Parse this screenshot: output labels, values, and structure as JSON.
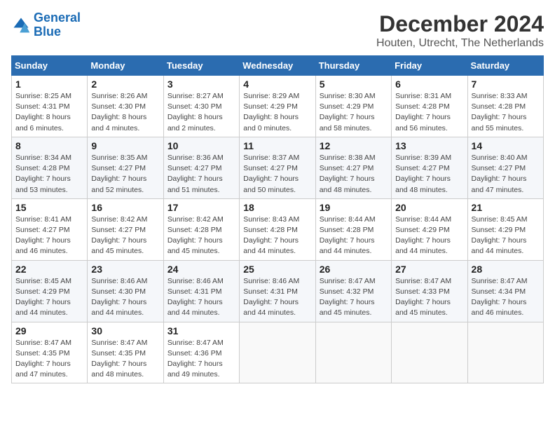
{
  "header": {
    "logo_line1": "General",
    "logo_line2": "Blue",
    "month": "December 2024",
    "location": "Houten, Utrecht, The Netherlands"
  },
  "weekdays": [
    "Sunday",
    "Monday",
    "Tuesday",
    "Wednesday",
    "Thursday",
    "Friday",
    "Saturday"
  ],
  "weeks": [
    [
      {
        "day": "1",
        "sunrise": "Sunrise: 8:25 AM",
        "sunset": "Sunset: 4:31 PM",
        "daylight": "Daylight: 8 hours and 6 minutes."
      },
      {
        "day": "2",
        "sunrise": "Sunrise: 8:26 AM",
        "sunset": "Sunset: 4:30 PM",
        "daylight": "Daylight: 8 hours and 4 minutes."
      },
      {
        "day": "3",
        "sunrise": "Sunrise: 8:27 AM",
        "sunset": "Sunset: 4:30 PM",
        "daylight": "Daylight: 8 hours and 2 minutes."
      },
      {
        "day": "4",
        "sunrise": "Sunrise: 8:29 AM",
        "sunset": "Sunset: 4:29 PM",
        "daylight": "Daylight: 8 hours and 0 minutes."
      },
      {
        "day": "5",
        "sunrise": "Sunrise: 8:30 AM",
        "sunset": "Sunset: 4:29 PM",
        "daylight": "Daylight: 7 hours and 58 minutes."
      },
      {
        "day": "6",
        "sunrise": "Sunrise: 8:31 AM",
        "sunset": "Sunset: 4:28 PM",
        "daylight": "Daylight: 7 hours and 56 minutes."
      },
      {
        "day": "7",
        "sunrise": "Sunrise: 8:33 AM",
        "sunset": "Sunset: 4:28 PM",
        "daylight": "Daylight: 7 hours and 55 minutes."
      }
    ],
    [
      {
        "day": "8",
        "sunrise": "Sunrise: 8:34 AM",
        "sunset": "Sunset: 4:28 PM",
        "daylight": "Daylight: 7 hours and 53 minutes."
      },
      {
        "day": "9",
        "sunrise": "Sunrise: 8:35 AM",
        "sunset": "Sunset: 4:27 PM",
        "daylight": "Daylight: 7 hours and 52 minutes."
      },
      {
        "day": "10",
        "sunrise": "Sunrise: 8:36 AM",
        "sunset": "Sunset: 4:27 PM",
        "daylight": "Daylight: 7 hours and 51 minutes."
      },
      {
        "day": "11",
        "sunrise": "Sunrise: 8:37 AM",
        "sunset": "Sunset: 4:27 PM",
        "daylight": "Daylight: 7 hours and 50 minutes."
      },
      {
        "day": "12",
        "sunrise": "Sunrise: 8:38 AM",
        "sunset": "Sunset: 4:27 PM",
        "daylight": "Daylight: 7 hours and 48 minutes."
      },
      {
        "day": "13",
        "sunrise": "Sunrise: 8:39 AM",
        "sunset": "Sunset: 4:27 PM",
        "daylight": "Daylight: 7 hours and 48 minutes."
      },
      {
        "day": "14",
        "sunrise": "Sunrise: 8:40 AM",
        "sunset": "Sunset: 4:27 PM",
        "daylight": "Daylight: 7 hours and 47 minutes."
      }
    ],
    [
      {
        "day": "15",
        "sunrise": "Sunrise: 8:41 AM",
        "sunset": "Sunset: 4:27 PM",
        "daylight": "Daylight: 7 hours and 46 minutes."
      },
      {
        "day": "16",
        "sunrise": "Sunrise: 8:42 AM",
        "sunset": "Sunset: 4:27 PM",
        "daylight": "Daylight: 7 hours and 45 minutes."
      },
      {
        "day": "17",
        "sunrise": "Sunrise: 8:42 AM",
        "sunset": "Sunset: 4:28 PM",
        "daylight": "Daylight: 7 hours and 45 minutes."
      },
      {
        "day": "18",
        "sunrise": "Sunrise: 8:43 AM",
        "sunset": "Sunset: 4:28 PM",
        "daylight": "Daylight: 7 hours and 44 minutes."
      },
      {
        "day": "19",
        "sunrise": "Sunrise: 8:44 AM",
        "sunset": "Sunset: 4:28 PM",
        "daylight": "Daylight: 7 hours and 44 minutes."
      },
      {
        "day": "20",
        "sunrise": "Sunrise: 8:44 AM",
        "sunset": "Sunset: 4:29 PM",
        "daylight": "Daylight: 7 hours and 44 minutes."
      },
      {
        "day": "21",
        "sunrise": "Sunrise: 8:45 AM",
        "sunset": "Sunset: 4:29 PM",
        "daylight": "Daylight: 7 hours and 44 minutes."
      }
    ],
    [
      {
        "day": "22",
        "sunrise": "Sunrise: 8:45 AM",
        "sunset": "Sunset: 4:29 PM",
        "daylight": "Daylight: 7 hours and 44 minutes."
      },
      {
        "day": "23",
        "sunrise": "Sunrise: 8:46 AM",
        "sunset": "Sunset: 4:30 PM",
        "daylight": "Daylight: 7 hours and 44 minutes."
      },
      {
        "day": "24",
        "sunrise": "Sunrise: 8:46 AM",
        "sunset": "Sunset: 4:31 PM",
        "daylight": "Daylight: 7 hours and 44 minutes."
      },
      {
        "day": "25",
        "sunrise": "Sunrise: 8:46 AM",
        "sunset": "Sunset: 4:31 PM",
        "daylight": "Daylight: 7 hours and 44 minutes."
      },
      {
        "day": "26",
        "sunrise": "Sunrise: 8:47 AM",
        "sunset": "Sunset: 4:32 PM",
        "daylight": "Daylight: 7 hours and 45 minutes."
      },
      {
        "day": "27",
        "sunrise": "Sunrise: 8:47 AM",
        "sunset": "Sunset: 4:33 PM",
        "daylight": "Daylight: 7 hours and 45 minutes."
      },
      {
        "day": "28",
        "sunrise": "Sunrise: 8:47 AM",
        "sunset": "Sunset: 4:34 PM",
        "daylight": "Daylight: 7 hours and 46 minutes."
      }
    ],
    [
      {
        "day": "29",
        "sunrise": "Sunrise: 8:47 AM",
        "sunset": "Sunset: 4:35 PM",
        "daylight": "Daylight: 7 hours and 47 minutes."
      },
      {
        "day": "30",
        "sunrise": "Sunrise: 8:47 AM",
        "sunset": "Sunset: 4:35 PM",
        "daylight": "Daylight: 7 hours and 48 minutes."
      },
      {
        "day": "31",
        "sunrise": "Sunrise: 8:47 AM",
        "sunset": "Sunset: 4:36 PM",
        "daylight": "Daylight: 7 hours and 49 minutes."
      },
      null,
      null,
      null,
      null
    ]
  ]
}
